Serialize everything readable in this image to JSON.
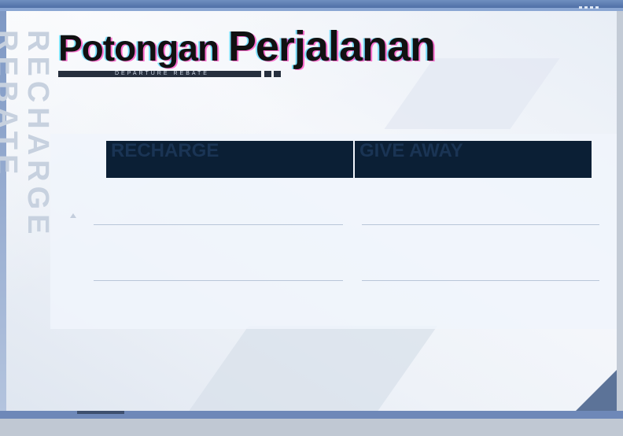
{
  "header": {
    "title_part1": "Potongan",
    "title_part2": "Perjalanan",
    "subtitle": "DEPARTURE REBATE"
  },
  "watermark": "RECHARGE REBATE",
  "tabs": [
    {
      "label": "RECHARGE"
    },
    {
      "label": "GIVE AWAY"
    }
  ],
  "colors": {
    "tab_background": "#0b1f35",
    "frame_accent": "#6e88b8"
  }
}
